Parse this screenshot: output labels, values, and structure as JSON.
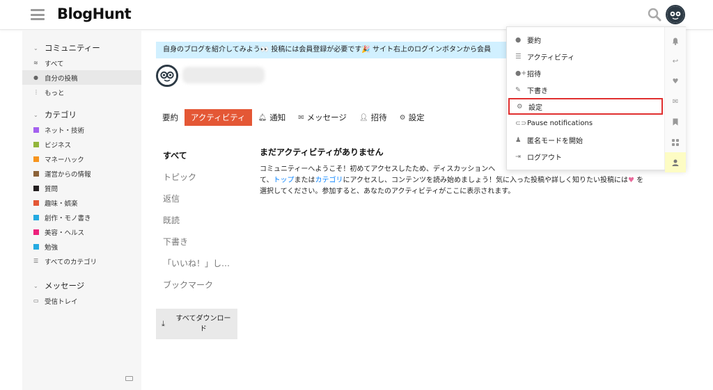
{
  "header": {
    "logo": "BlogHunt"
  },
  "sidebar": {
    "community": {
      "title": "コミュニティー",
      "items": [
        {
          "label": "すべて",
          "icon": "layers-icon"
        },
        {
          "label": "自分の投稿",
          "icon": "user-icon"
        },
        {
          "label": "もっと",
          "icon": "more-vertical-icon"
        }
      ]
    },
    "categories": {
      "title": "カテゴリ",
      "items": [
        {
          "label": "ネット・技術",
          "color": "#a461ef"
        },
        {
          "label": "ビジネス",
          "color": "#92b53b"
        },
        {
          "label": "マネーハック",
          "color": "#f7941d"
        },
        {
          "label": "運営からの情報",
          "color": "#8c6238"
        },
        {
          "label": "質問",
          "color": "#231f20"
        },
        {
          "label": "趣味・娯楽",
          "color": "#e45735"
        },
        {
          "label": "創作・モノ書き",
          "color": "#25aae1"
        },
        {
          "label": "美容・ヘルス",
          "color": "#ed207b"
        },
        {
          "label": "勉強",
          "color": "#25aae1"
        }
      ],
      "all_label": "すべてのカテゴリ"
    },
    "messages": {
      "title": "メッセージ",
      "inbox": "受信トレイ"
    }
  },
  "banner": {
    "text": "自身のブログを紹介してみよう👀 投稿には会員登録が必要です🎉 サイト右上のログインボタンから会員"
  },
  "tabs": [
    {
      "label": "要約",
      "icon": ""
    },
    {
      "label": "アクティビティ",
      "icon": ""
    },
    {
      "label": "通知",
      "icon": "bell-icon"
    },
    {
      "label": "メッセージ",
      "icon": "envelope-icon"
    },
    {
      "label": "招待",
      "icon": "user-plus-icon"
    },
    {
      "label": "設定",
      "icon": "gear-icon"
    }
  ],
  "subnav": [
    "すべて",
    "トピック",
    "返信",
    "既読",
    "下書き",
    "「いいね！」し…",
    "ブックマーク"
  ],
  "download": {
    "label_line1": "すべてダウンロー",
    "label_line2": "ド"
  },
  "empty": {
    "title": "まだアクティビティがありません",
    "line1_a": "コミュニティーへようこそ！初めてアクセスしたため、ディスカッションへ",
    "line2_a": "て、",
    "link_top": "トップ",
    "line2_b": "または",
    "link_category": "カテゴリ",
    "line2_c": "にアクセスし、コンテンツを読み始めましょう！気に入った投稿や詳しく知りたい投稿には",
    "heart": "♥",
    "line2_d": " を",
    "line3": "選択してください。参加すると、あなたのアクティビティがここに表示されます。"
  },
  "dropdown": {
    "items": [
      {
        "label": "要約",
        "icon": "user-icon"
      },
      {
        "label": "アクティビティ",
        "icon": "list-icon"
      },
      {
        "label": "招待",
        "icon": "user-plus-icon"
      },
      {
        "label": "下書き",
        "icon": "pencil-icon"
      },
      {
        "label": "設定",
        "icon": "gear-icon"
      },
      {
        "label": "Pause notifications",
        "icon": "toggle-icon"
      },
      {
        "label": "匿名モードを開始",
        "icon": "anonymous-icon"
      },
      {
        "label": "ログアウト",
        "icon": "sign-out-icon"
      }
    ],
    "highlight_color": "#e02f2f"
  },
  "colors": {
    "accent": "#e45735",
    "banner": "#d1f0ff",
    "link": "#0a84ff"
  }
}
